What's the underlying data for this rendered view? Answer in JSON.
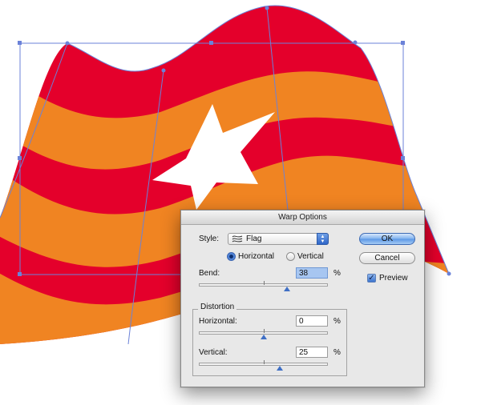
{
  "artwork": {
    "colors": {
      "red_stripe": "#e4002b",
      "orange_stripe": "#f08422",
      "star": "#ffffff",
      "envelope_mesh": "#6b82d8"
    }
  },
  "dialog": {
    "title": "Warp Options",
    "style_label": "Style:",
    "style_value": "Flag",
    "style_icon": "flag-warp-icon",
    "orientation": {
      "horizontal_label": "Horizontal",
      "vertical_label": "Vertical",
      "selected": "Horizontal"
    },
    "bend": {
      "label": "Bend:",
      "value": "38",
      "unit": "%"
    },
    "distortion": {
      "group_label": "Distortion",
      "horizontal": {
        "label": "Horizontal:",
        "value": "0",
        "unit": "%"
      },
      "vertical": {
        "label": "Vertical:",
        "value": "25",
        "unit": "%"
      }
    },
    "buttons": {
      "ok": "OK",
      "cancel": "Cancel"
    },
    "preview": {
      "label": "Preview",
      "checked": true
    }
  }
}
